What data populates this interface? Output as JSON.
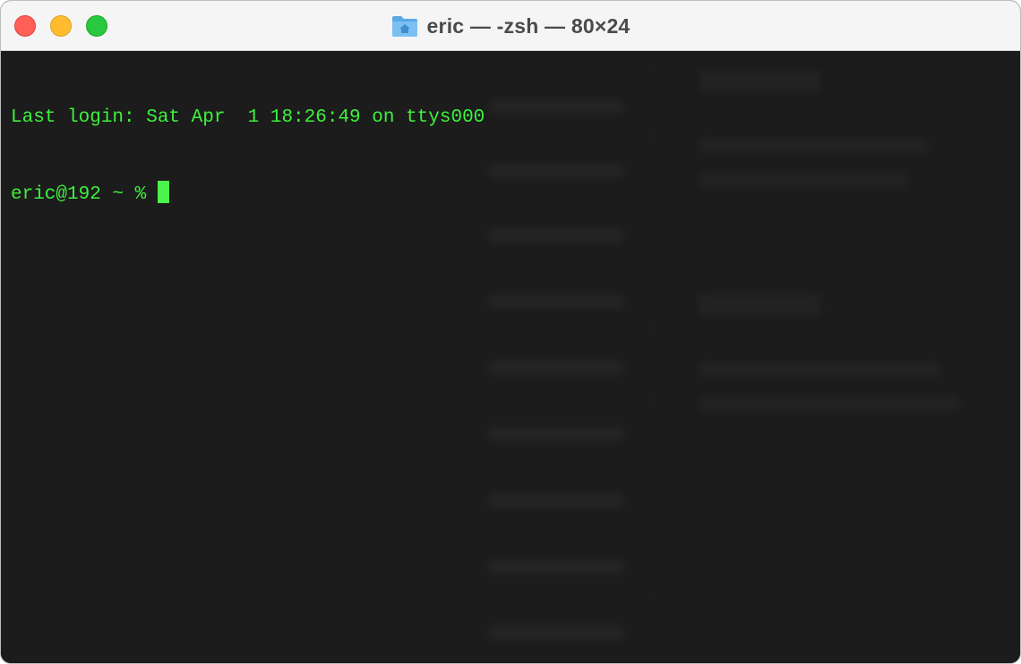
{
  "window": {
    "title": "eric — -zsh — 80×24",
    "title_icon": "home-folder-icon"
  },
  "traffic_lights": {
    "close_color": "#fe5f57",
    "minimize_color": "#febc2e",
    "zoom_color": "#28c840"
  },
  "terminal": {
    "text_color": "#3df23d",
    "background": "#1c1c1c",
    "lines": [
      "Last login: Sat Apr  1 18:26:49 on ttys000",
      "eric@192 ~ % "
    ],
    "cursor_color": "#4cf24c"
  }
}
